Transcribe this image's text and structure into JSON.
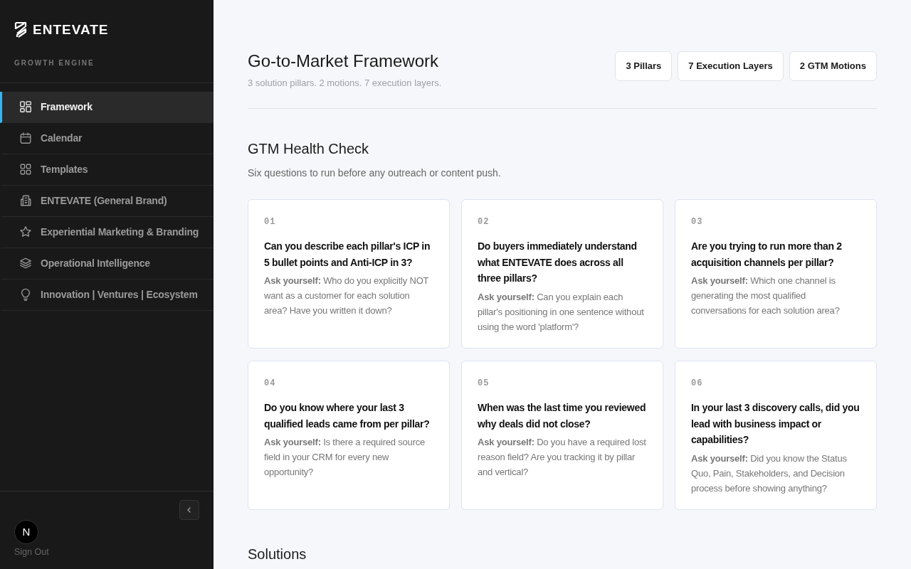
{
  "brand": {
    "name": "ENTEVATE",
    "tagline": "GROWTH ENGINE"
  },
  "sidebar": {
    "items": [
      {
        "label": "Framework",
        "selected": true
      },
      {
        "label": "Calendar",
        "selected": false
      },
      {
        "label": "Templates",
        "selected": false
      },
      {
        "label": "ENTEVATE (General Brand)",
        "selected": false
      },
      {
        "label": "Experiential Marketing & Branding",
        "selected": false
      },
      {
        "label": "Operational Intelligence",
        "selected": false
      },
      {
        "label": "Innovation | Ventures | Ecosystem",
        "selected": false
      }
    ],
    "avatar": "N",
    "sign_out": "Sign Out"
  },
  "header": {
    "title": "Go-to-Market Framework",
    "subtitle": "3 solution pillars. 2 motions. 7 execution layers.",
    "stats": [
      "3 Pillars",
      "7 Execution Layers",
      "2 GTM Motions"
    ]
  },
  "health_check": {
    "title": "GTM Health Check",
    "subtitle": "Six questions to run before any outreach or content push.",
    "cards": [
      {
        "number": "01",
        "question": "Can you describe each pillar's ICP in 5 bullet points and Anti-ICP in 3?",
        "prompt": "**Ask yourself:** Who do you explicitly NOT want as a customer for each solution area? Have you written it down?"
      },
      {
        "number": "02",
        "question": "Do buyers immediately understand what ENTEVATE does across all three pillars?",
        "prompt": "**Ask yourself:** Can you explain each pillar's positioning in one sentence without using the word 'platform'?"
      },
      {
        "number": "03",
        "question": "Are you trying to run more than 2 acquisition channels per pillar?",
        "prompt": "**Ask yourself:** Which one channel is generating the most qualified conversations for each solution area?"
      },
      {
        "number": "04",
        "question": "Do you know where your last 3 qualified leads came from per pillar?",
        "prompt": "**Ask yourself:** Is there a required source field in your CRM for every new opportunity?"
      },
      {
        "number": "05",
        "question": "When was the last time you reviewed why deals did not close?",
        "prompt": "**Ask yourself:** Do you have a required lost reason field? Are you tracking it by pillar and vertical?"
      },
      {
        "number": "06",
        "question": "In your last 3 discovery calls, did you lead with business impact or capabilities?",
        "prompt": "**Ask yourself:** Did you know the Status Quo, Pain, Stakeholders, and Decision process before showing anything?"
      }
    ]
  },
  "solutions": {
    "title": "Solutions"
  }
}
